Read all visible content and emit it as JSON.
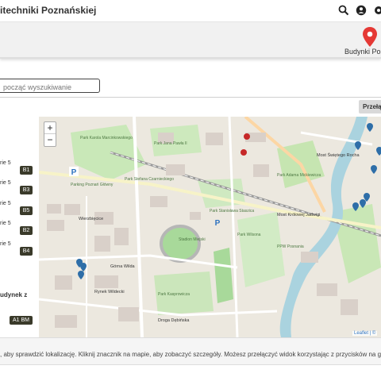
{
  "header": {
    "title": "itechniki Poznańskiej",
    "icons": [
      "search-icon",
      "account-icon",
      "settings-icon"
    ]
  },
  "banner": {
    "label": "Budynki Pol",
    "pin_icon": "map-pin-icon",
    "pin_color": "#e53935"
  },
  "search": {
    "placeholder": "począć wyszukiwanie"
  },
  "toolbar": {
    "switch_label": "Przełą"
  },
  "building_list": {
    "items": [
      {
        "text": "rie 5",
        "badge": "B1"
      },
      {
        "text": "rie 5",
        "badge": "B3"
      },
      {
        "text": "rie 5",
        "badge": "B5"
      },
      {
        "text": "rie 5",
        "badge": "B2"
      },
      {
        "text": "rie 5",
        "badge": "B4"
      }
    ],
    "group_heading": "udynek z",
    "group_badge": "A1 BM"
  },
  "map": {
    "zoom_in": "+",
    "zoom_out": "−",
    "labels": {
      "park_1": "Park Karola Marcinkowskiego",
      "park_2": "Park Jana Pawła II",
      "park_3": "Park Stefana Czarnieckiego",
      "park_4": "Park Adama Mickiewicza",
      "park_5": "Park Kasprowicza",
      "park_6": "Park Wilsona",
      "street_1": "Most Świętego Rocha",
      "street_2": "Most Królowej Jadwigi",
      "street_3": "Wierzbięcice",
      "street_4": "Górna Wilda",
      "street_5": "Rynek Wildecki",
      "street_6": "Droga Dębińska",
      "park_7": "Park Stanisława Staszica",
      "stadium": "Stadion Miejski",
      "parking": "P",
      "parking_label": "Parking Poznań Główny",
      "pow_pl": "PPW Posnania"
    },
    "marker_color": "#2e6ea8",
    "attribution": "Leaflet | ©"
  },
  "footer": {
    "text": ", aby sprawdzić lokalizację. Kliknij znacznik na mapie, aby zobaczyć szczegóły. Możesz przełączyć widok korzystając z przycisków na gór"
  }
}
